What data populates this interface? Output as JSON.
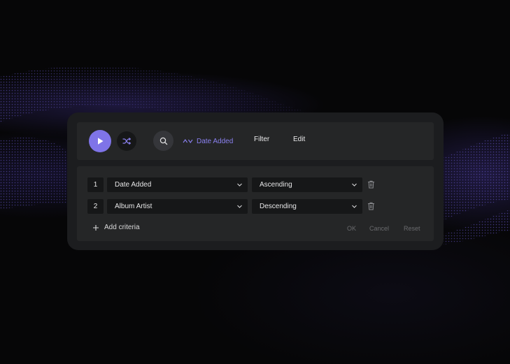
{
  "colors": {
    "accent": "#7f74e8",
    "accent_text": "#8a80ef",
    "panel": "#1c1d1f",
    "surface": "#252627",
    "field": "#161718",
    "muted": "#6a6b6e"
  },
  "toolbar": {
    "play_icon": "play-icon",
    "shuffle_icon": "shuffle-icon",
    "search_icon": "search-icon",
    "sort_direction_icon": "sort-direction-icon",
    "sort_label": "Date Added",
    "filter_label": "Filter",
    "edit_label": "Edit"
  },
  "criteria": {
    "rows": [
      {
        "index": "1",
        "field": "Date Added",
        "order": "Ascending"
      },
      {
        "index": "2",
        "field": "Album Artist",
        "order": "Descending"
      }
    ],
    "add_label": "Add criteria",
    "ok_label": "OK",
    "cancel_label": "Cancel",
    "reset_label": "Reset"
  }
}
